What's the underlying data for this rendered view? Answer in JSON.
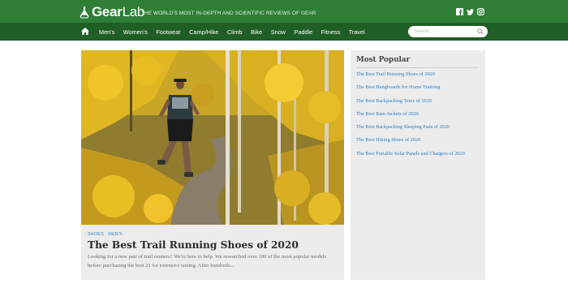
{
  "header": {
    "logo_bold": "Gear",
    "logo_light": "Lab",
    "tagline": "THE WORLD'S MOST IN-DEPTH AND SCIENTIFIC REVIEWS OF GEAR",
    "social_icons": [
      "facebook-icon",
      "twitter-icon",
      "instagram-icon"
    ],
    "brand_green": "#2f7d36",
    "nav_green": "#1f5e25"
  },
  "nav": {
    "items": [
      "Men's",
      "Women's",
      "Footwear",
      "Camp/Hike",
      "Climb",
      "Bike",
      "Snow",
      "Paddle",
      "Fitness",
      "Travel"
    ]
  },
  "search": {
    "placeholder": "Search...",
    "value": ""
  },
  "featured": {
    "kicker_1": "SHOES",
    "kicker_sep": " · ",
    "kicker_2": "MEN'S",
    "title": "The Best Trail Running Shoes of 2020",
    "excerpt": "Looking for a new pair of trail runners? We're here to help. We researched over 100 of the most popular models before purchasing the best 21 for extensive testing. After hundreds..."
  },
  "sidebar": {
    "heading": "Most Popular",
    "items": [
      "The Best Trail Running Shoes of 2020",
      "The Best Hangboards for Home Training",
      "The Best Backpacking Tents of 2020",
      "The Best Rain Jackets of 2020",
      "The Best Backpacking Sleeping Pads of 2020",
      "The Best Hiking Shoes of 2020",
      "The Best Portable Solar Panels and Chargers of 2020"
    ],
    "link_color": "#2f7fc1"
  }
}
